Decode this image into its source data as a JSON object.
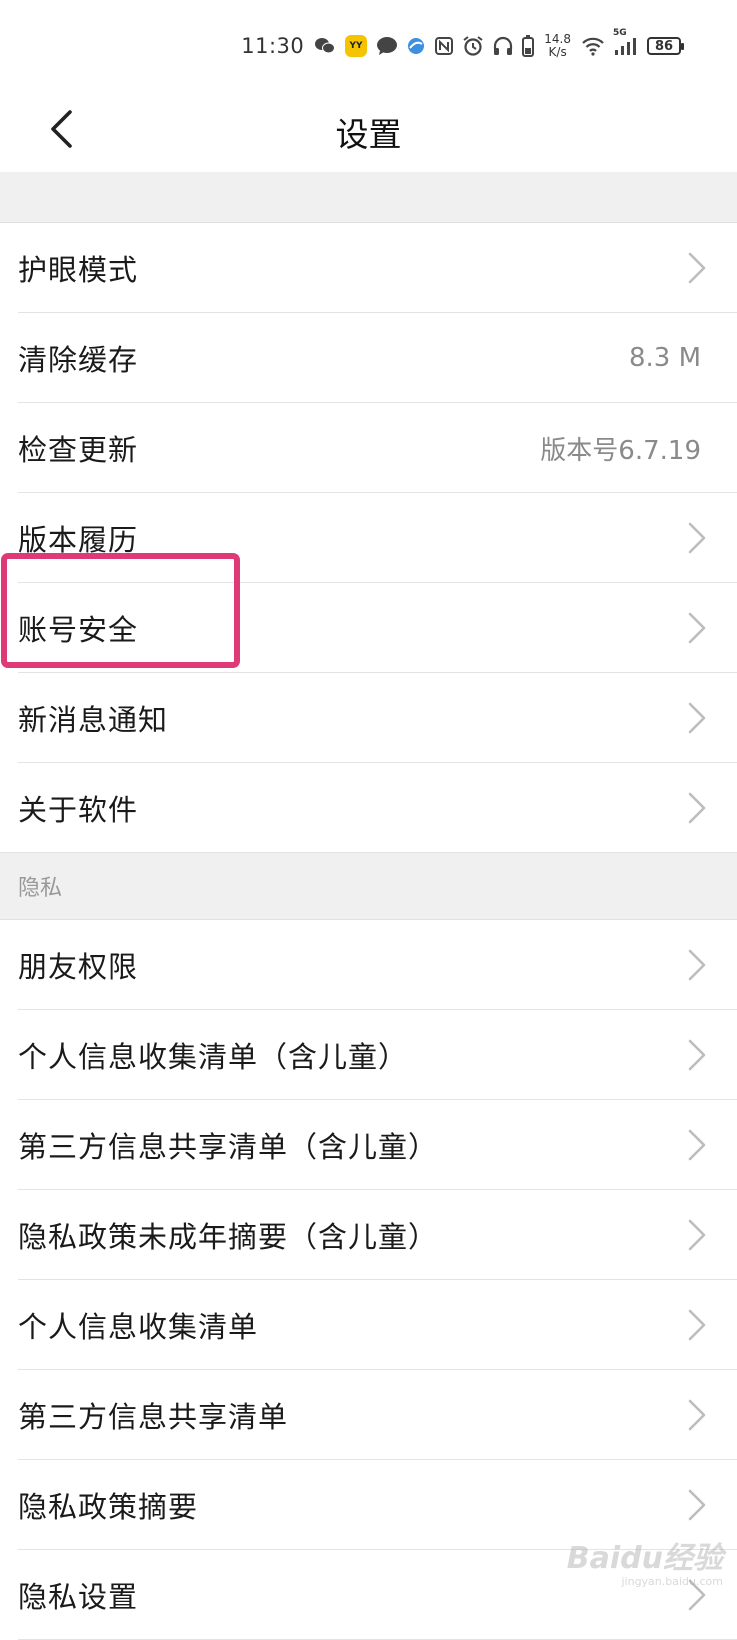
{
  "status_bar": {
    "time": "11:30",
    "speed_value": "14.8",
    "speed_unit": "K/s",
    "network": "5G",
    "battery": "86",
    "icons": [
      "wechat-icon",
      "yy-app-icon",
      "message-icon",
      "browser-icon",
      "nfc-icon",
      "alarm-icon",
      "headphones-icon",
      "battery-saver-icon",
      "wifi-icon",
      "signal-icon"
    ]
  },
  "nav": {
    "title": "设置",
    "back_icon": "chevron-left-icon"
  },
  "general_items": [
    {
      "label": "护眼模式",
      "value": "",
      "chevron": true
    },
    {
      "label": "清除缓存",
      "value": "8.3 M",
      "chevron": false
    },
    {
      "label": "检查更新",
      "value": "版本号6.7.19",
      "chevron": false
    },
    {
      "label": "版本履历",
      "value": "",
      "chevron": true
    },
    {
      "label": "账号安全",
      "value": "",
      "chevron": true
    },
    {
      "label": "新消息通知",
      "value": "",
      "chevron": true
    },
    {
      "label": "关于软件",
      "value": "",
      "chevron": true
    }
  ],
  "privacy_section": {
    "header": "隐私",
    "items": [
      {
        "label": "朋友权限"
      },
      {
        "label": "个人信息收集清单（含儿童）"
      },
      {
        "label": "第三方信息共享清单（含儿童）"
      },
      {
        "label": "隐私政策未成年摘要（含儿童）"
      },
      {
        "label": "个人信息收集清单"
      },
      {
        "label": "第三方信息共享清单"
      },
      {
        "label": "隐私政策摘要"
      },
      {
        "label": "隐私设置"
      }
    ]
  },
  "highlight_color": "#df3a78",
  "watermark": {
    "main": "Baidu经验",
    "sub": "jingyan.baidu.com"
  }
}
